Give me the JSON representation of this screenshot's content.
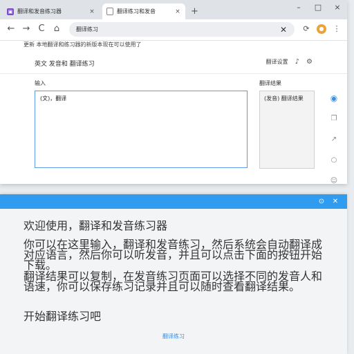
{
  "browser": {
    "tabs": [
      {
        "title": "翻译和发音练习器",
        "close": "×"
      },
      {
        "title": "翻译练习和发音",
        "close": "×"
      }
    ],
    "newtab": "+",
    "window_controls": {
      "minimize": "–",
      "maximize": "□",
      "close": "×"
    },
    "toolbar": {
      "back": "←",
      "forward": "→",
      "reload": "C",
      "home": "⌂",
      "address": "翻译练习",
      "clear": "✕"
    }
  },
  "page": {
    "infobar": "更新 本地翻译和练习器的新版本现在可以使用了",
    "title": "英文 发音和 翻译练习",
    "header_right": {
      "label": "翻译设置",
      "bell": "🔔",
      "gear": "⚙"
    },
    "source_label": "输入",
    "target_label": "翻译结果",
    "source_text": "(文)，翻译",
    "target_text": "(发音) 翻译结果"
  },
  "panel": {
    "para1": "欢迎使用，翻译和发音练习器",
    "para2": "你可以在这里输入，翻译和发音练习，然后系统会自动翻译成对应语言，然后你可以听发音，并且可以点击下面的按钮开始下载。",
    "para3": "翻译结果可以复制，在发音练习页面可以选择不同的发音人和语速，你可以保存练习记录并且可以随时查看翻译结果。",
    "para4": "开始翻译练习吧",
    "link": "翻译练习"
  }
}
